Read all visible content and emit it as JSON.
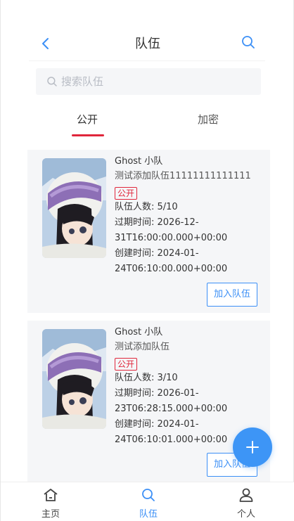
{
  "header": {
    "title": "队伍"
  },
  "search": {
    "placeholder": "搜索队伍"
  },
  "tabs": [
    {
      "label": "公开",
      "active": true
    },
    {
      "label": "加密",
      "active": false
    }
  ],
  "teams": [
    {
      "name": "Ghost 小队",
      "description": "测试添加队伍11111111111111",
      "status": "公开",
      "members_line": "队伍人数: 5/10",
      "expire_line1": "过期时间: 2026-12-",
      "expire_line2": "31T16:00:00.000+00:00",
      "created_line1": "创建时间: 2024-01-",
      "created_line2": "24T06:10:00.000+00:00",
      "join_label": "加入队伍"
    },
    {
      "name": "Ghost 小队",
      "description": "测试添加队伍",
      "status": "公开",
      "members_line": "队伍人数: 3/10",
      "expire_line1": "过期时间: 2026-01-",
      "expire_line2": "23T06:28:15.000+00:00",
      "created_line1": "创建时间: 2024-01-",
      "created_line2": "24T06:10:01.000+00:00",
      "join_label": "加入队伍"
    }
  ],
  "tabbar": {
    "home": "主页",
    "team": "队伍",
    "profile": "个人"
  },
  "colors": {
    "accent": "#3b8ff6",
    "danger": "#e0263b",
    "card_bg": "#f5f6f8"
  },
  "icons": {
    "back": "chevron-left-icon",
    "search": "search-icon",
    "fab": "plus-icon",
    "home": "home-icon",
    "team": "search-icon",
    "profile": "user-icon"
  }
}
